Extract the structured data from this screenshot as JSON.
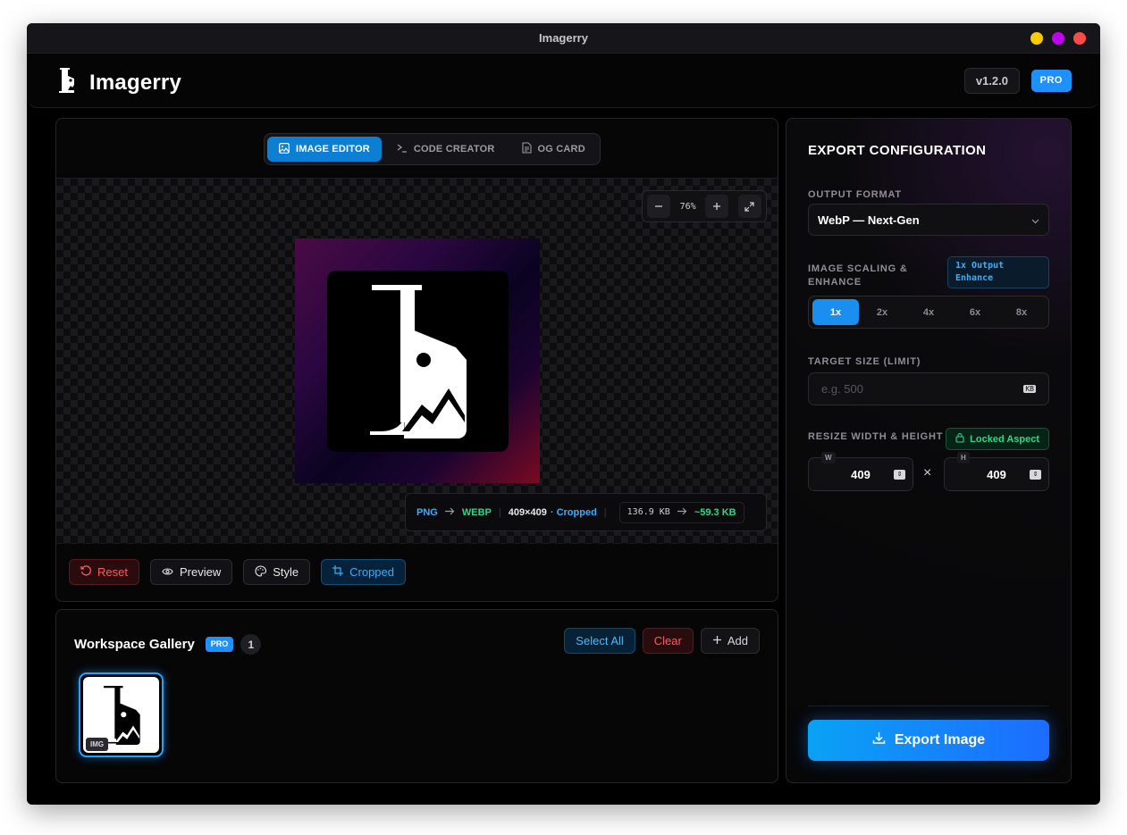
{
  "window": {
    "title": "Imagerry",
    "controls": [
      "minimize",
      "maximize",
      "close"
    ],
    "colors": {
      "minimize": "#ffcc00",
      "maximize": "#c200f0",
      "close": "#ff4a4a"
    }
  },
  "header": {
    "app_name": "Imagerry",
    "version": "v1.2.0",
    "badge": "PRO"
  },
  "editor": {
    "tabs": [
      {
        "label": "IMAGE EDITOR",
        "icon": "image-icon",
        "active": true
      },
      {
        "label": "CODE CREATOR",
        "icon": "terminal-icon",
        "active": false
      },
      {
        "label": "OG CARD",
        "icon": "document-icon",
        "active": false
      }
    ],
    "zoom": {
      "value": "76%"
    },
    "info": {
      "from_format": "PNG",
      "to_format": "WEBP",
      "dimensions": "409×409",
      "crop_status": "· Cropped",
      "original_size": "136.9 KB",
      "new_size": "~59.3 KB"
    },
    "actions": {
      "reset": "Reset",
      "preview": "Preview",
      "style": "Style",
      "cropped": "Cropped"
    }
  },
  "gallery": {
    "title": "Workspace Gallery",
    "badge": "PRO",
    "count": "1",
    "select_all": "Select All",
    "clear": "Clear",
    "add": "Add",
    "items": [
      {
        "tag": "IMG",
        "selected": true
      }
    ]
  },
  "export": {
    "title": "EXPORT CONFIGURATION",
    "output_format_label": "OUTPUT FORMAT",
    "output_format_value": "WebP — Next-Gen",
    "scaling_label": "IMAGE SCALING & ENHANCE",
    "enhance_badge": "1x Output Enhance",
    "scales": [
      "1x",
      "2x",
      "4x",
      "6x",
      "8x"
    ],
    "active_scale": "1x",
    "target_label": "TARGET SIZE (LIMIT)",
    "target_placeholder": "e.g. 500",
    "target_unit": "KB",
    "resize_label": "RESIZE WIDTH & HEIGHT",
    "locked_label": "Locked Aspect",
    "width_label": "W",
    "width_value": "409",
    "height_label": "H",
    "height_value": "409",
    "times": "×",
    "export_button": "Export Image"
  },
  "colors": {
    "accent": "#1a8ff0",
    "danger": "#ff5a5f",
    "success": "#2fd58a"
  }
}
